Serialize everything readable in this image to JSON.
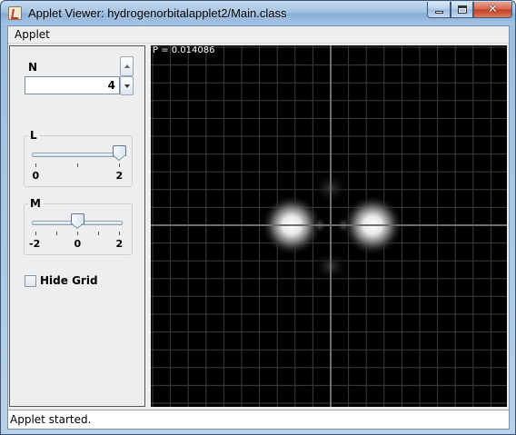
{
  "window": {
    "title": "Applet Viewer: hydrogenorbitalapplet2/Main.class",
    "minimize_icon": "minimize-icon",
    "maximize_icon": "maximize-icon",
    "close_glyph": "✕"
  },
  "menu": {
    "items": [
      "Applet"
    ]
  },
  "controls": {
    "n": {
      "label": "N",
      "value": "4"
    },
    "l": {
      "label": "L",
      "min": 0,
      "max": 2,
      "value": 2,
      "tick_labels": [
        "0",
        "2"
      ]
    },
    "m": {
      "label": "M",
      "min": -2,
      "max": 2,
      "value": 0,
      "tick_labels": [
        "-2",
        "0",
        "2"
      ]
    },
    "hide_grid": {
      "label": "Hide Grid",
      "checked": false
    }
  },
  "canvas": {
    "probability_readout": "P = 0.014086",
    "grid_color": "#3c3c3c",
    "axis_color": "#6e6e6e",
    "background": "#000000"
  },
  "status": {
    "text": "Applet started."
  }
}
